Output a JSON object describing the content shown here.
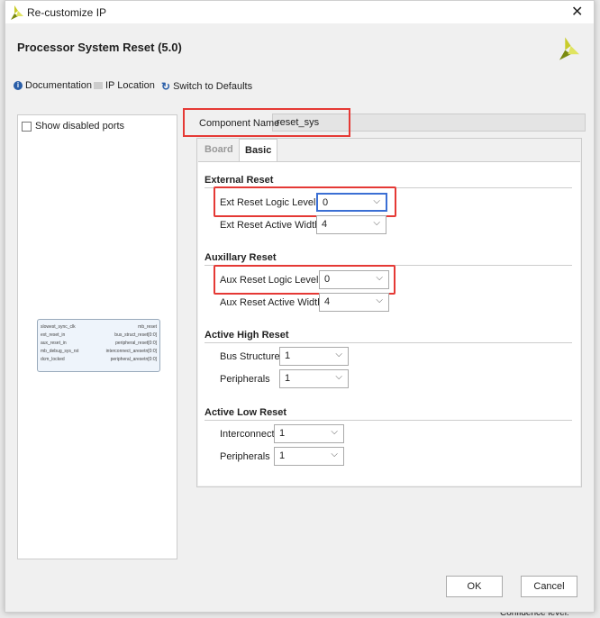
{
  "window": {
    "title": "Re-customize IP",
    "close": "✕"
  },
  "header": {
    "ip_name": "Processor System Reset (5.0)"
  },
  "toolbar": {
    "documentation": "Documentation",
    "ip_location": "IP Location",
    "switch_defaults": "Switch to Defaults"
  },
  "left": {
    "show_disabled_ports": "Show disabled ports",
    "ports_left": [
      "slowest_sync_clk",
      "ext_reset_in",
      "aux_reset_in",
      "mb_debug_sys_rst",
      "dcm_locked"
    ],
    "ports_right": [
      "mb_reset",
      "bus_struct_reset[0:0]",
      "peripheral_reset[0:0]",
      "interconnect_aresetn[0:0]",
      "peripheral_aresetn[0:0]"
    ]
  },
  "component": {
    "label": "Component Name",
    "value": "reset_sys"
  },
  "tabs": [
    "Board",
    "Basic"
  ],
  "sections": {
    "ext": {
      "title": "External Reset",
      "logic_label": "Ext Reset Logic Level",
      "logic_value": "0",
      "width_label": "Ext Reset Active Width",
      "width_value": "4"
    },
    "aux": {
      "title": "Auxillary Reset",
      "logic_label": "Aux Reset Logic Level",
      "logic_value": "0",
      "width_label": "Aux Reset Active Width",
      "width_value": "4"
    },
    "high": {
      "title": "Active High Reset",
      "bus_label": "Bus Structure",
      "bus_value": "1",
      "per_label": "Peripherals",
      "per_value": "1"
    },
    "low": {
      "title": "Active Low Reset",
      "ic_label": "Interconnect",
      "ic_value": "1",
      "per_label": "Peripherals",
      "per_value": "1"
    }
  },
  "buttons": {
    "ok": "OK",
    "cancel": "Cancel"
  },
  "background": {
    "bottom_text": "Confidence level:"
  },
  "colors": {
    "highlight": "#e53935",
    "focus": "#3b6fd4",
    "logo": "#a8b820"
  }
}
